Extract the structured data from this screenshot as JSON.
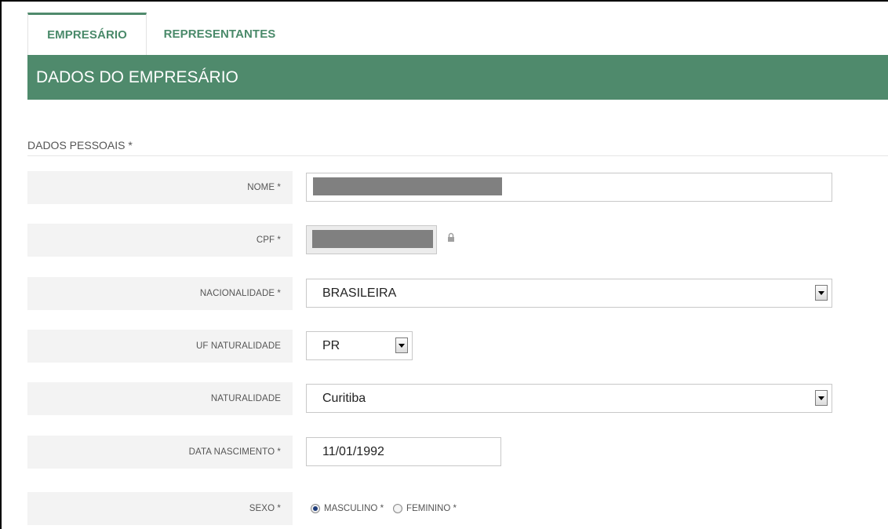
{
  "tabs": [
    {
      "label": "EMPRESÁRIO",
      "active": true
    },
    {
      "label": "REPRESENTANTES",
      "active": false
    }
  ],
  "section": {
    "title": "DADOS DO EMPRESÁRIO"
  },
  "subsection": {
    "title": "DADOS PESSOAIS *"
  },
  "fields": {
    "nome": {
      "label": "NOME *",
      "value": ""
    },
    "cpf": {
      "label": "CPF *",
      "value": "",
      "locked": true
    },
    "nacionalidade": {
      "label": "NACIONALIDADE *",
      "value": "BRASILEIRA"
    },
    "uf_naturalidade": {
      "label": "UF NATURALIDADE",
      "value": "PR"
    },
    "naturalidade": {
      "label": "NATURALIDADE",
      "value": "Curitiba"
    },
    "data_nascimento": {
      "label": "DATA NASCIMENTO *",
      "value": "11/01/1992"
    },
    "sexo": {
      "label": "SEXO *",
      "options": [
        {
          "label": "MASCULINO *",
          "selected": true
        },
        {
          "label": "FEMININO *",
          "selected": false
        }
      ]
    }
  },
  "icons": {
    "cpf_lock": "lock-icon"
  },
  "colors": {
    "accent": "#4f8a6c",
    "tab_text": "#4a8a6a",
    "label_bg": "#f3f3f3"
  }
}
